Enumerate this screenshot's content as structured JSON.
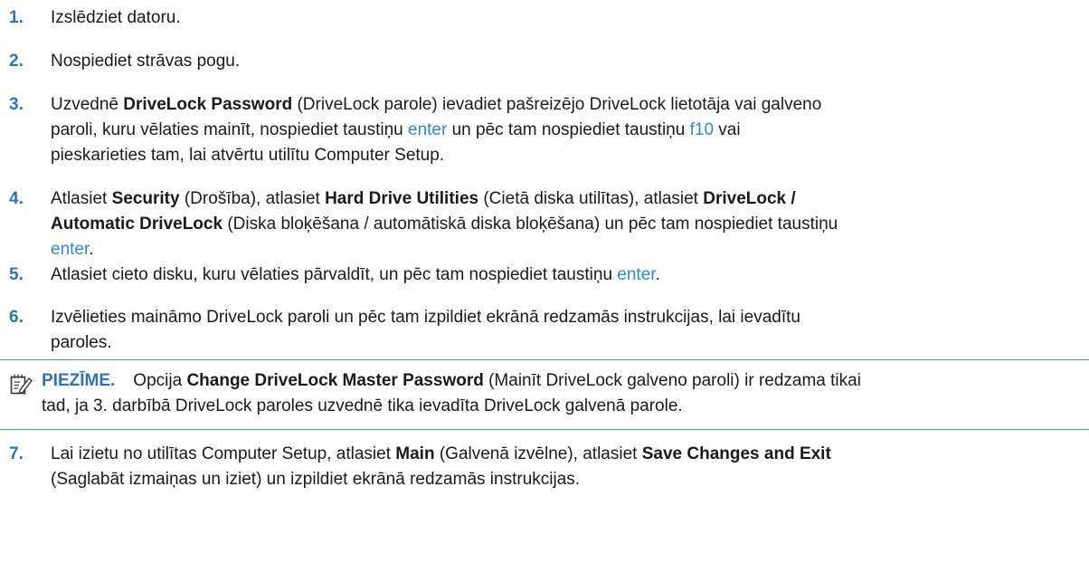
{
  "steps": [
    {
      "number": "1.",
      "parts": [
        "Izslēdziet datoru."
      ]
    },
    {
      "number": "2.",
      "parts": [
        "Nospiediet strāvas pogu."
      ]
    },
    {
      "number": "3.",
      "line1_pre": "Uzvednē ",
      "line1_bold": "DriveLock Password",
      "line1_post": " (DriveLock parole) ievadiet pašreizējo DriveLock lietotāja vai galveno",
      "line2_pre": "paroli, kuru vēlaties mainīt, nospiediet taustiņu ",
      "line2_key1": "enter",
      "line2_mid": " un pēc tam nospiediet taustiņu ",
      "line2_key2": "f10",
      "line2_post": " vai",
      "line3": "pieskarieties tam, lai atvērtu utilītu Computer Setup."
    },
    {
      "number": "4.",
      "line1_pre": "Atlasiet ",
      "line1_bold1": "Security",
      "line1_mid1": " (Drošība), atlasiet ",
      "line1_bold2": "Hard Drive Utilities",
      "line1_mid2": " (Cietā diska utilītas), atlasiet ",
      "line1_bold3": "DriveLock /",
      "line2_bold": "Automatic DriveLock",
      "line2_post": " (Diska bloķēšana / automātiskā diska bloķēšana) un pēc tam nospiediet taustiņu",
      "line3_key": "enter",
      "line3_post": "."
    },
    {
      "number": "5.",
      "pre": "Atlasiet cieto disku, kuru vēlaties pārvaldīt, un pēc tam nospiediet taustiņu ",
      "key": "enter",
      "post": "."
    },
    {
      "number": "6.",
      "line1": "Izvēlieties maināmo DriveLock paroli un pēc tam izpildiet ekrānā redzamās instrukcijas, lai ievadītu",
      "line2": "paroles."
    },
    {
      "number": "7.",
      "line1_pre": "Lai izietu no utilītas Computer Setup, atlasiet ",
      "line1_bold1": "Main",
      "line1_mid": " (Galvenā izvēlne), atlasiet ",
      "line1_bold2": "Save Changes and Exit",
      "line2": "(Saglabāt izmaiņas un iziet) un izpildiet ekrānā redzamās instrukcijas."
    }
  ],
  "note": {
    "icon": "note-pencil-icon",
    "label": "PIEZĪME.",
    "line1_pre": "Opcija ",
    "line1_bold": "Change DriveLock Master Password",
    "line1_post": " (Mainīt DriveLock galveno paroli) ir redzama tikai",
    "line2": "tad, ja 3. darbībā DriveLock paroles uzvednē tika ievadīta DriveLock galvenā parole."
  },
  "colors": {
    "accent": "#2f73b5",
    "key": "#2f88c9",
    "text": "#1a1a1a",
    "rule": "#4a8fc6"
  }
}
